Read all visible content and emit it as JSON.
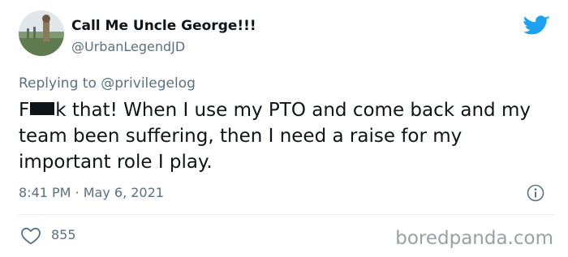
{
  "author": {
    "display_name": "Call Me Uncle George!!!",
    "handle": "@UrbanLegendJD",
    "avatar_icon": "avatar-photo"
  },
  "reply": {
    "prefix": "Replying to ",
    "mention": "@privilegelog"
  },
  "tweet": {
    "text_start": "F",
    "text_rest": "k that! When I use my PTO and come back and my team been suffering, then I need a raise for my important role I play."
  },
  "meta": {
    "timestamp": "8:41 PM · May 6, 2021"
  },
  "engagement": {
    "likes": "855"
  },
  "watermark": "boredpanda.com",
  "colors": {
    "brand": "#1da1f2",
    "secondary_text": "#5b7083",
    "primary_text": "#0f1419"
  }
}
